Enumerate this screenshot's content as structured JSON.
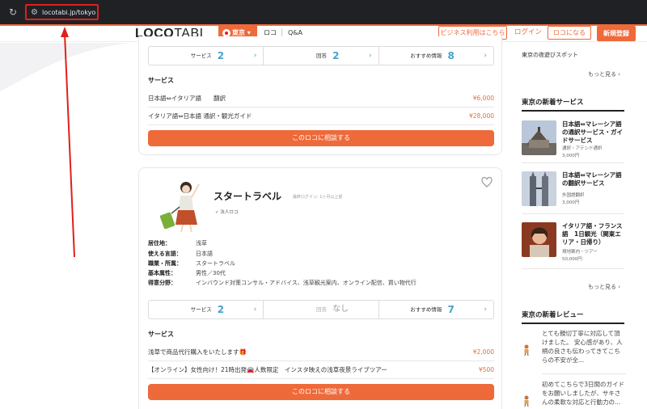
{
  "browser": {
    "url": "locotabi.jp/tokyo"
  },
  "header": {
    "logo_bold": "LOCO",
    "logo_thin": "TABI",
    "area": "東京",
    "nav": [
      "ロコ",
      "Q&A"
    ],
    "business_btn": "ビジネス利用はこちら",
    "login": "ログイン",
    "become_loco": "ロコになる",
    "signup": "新規登録",
    "accent": "#ee6a3a"
  },
  "card1": {
    "stats": [
      {
        "label": "サービス",
        "value": "2"
      },
      {
        "label": "回答",
        "value": "2"
      },
      {
        "label": "おすすめ情報",
        "value": "8"
      }
    ],
    "section": "サービス",
    "services": [
      {
        "name": "日本語⇔イタリア語　　翻訳",
        "price": "¥6,000"
      },
      {
        "name": "イタリア語⇔日本語 通訳・観光ガイド",
        "price": "¥28,000"
      }
    ],
    "cta": "このロコに相談する"
  },
  "card2": {
    "name": "スタートラベル",
    "last_login": "最終ログイン: 1ヶ月以上前",
    "corp_tag": "✓ 法人ロコ",
    "info": [
      {
        "label": "居住地：",
        "value": "浅草"
      },
      {
        "label": "使える言語：",
        "value": "日本語"
      },
      {
        "label": "職業・所属：",
        "value": "スタートラベル"
      },
      {
        "label": "基本属性：",
        "value": "男性／30代"
      },
      {
        "label": "得意分野：",
        "value": "インバウンド対策コンサル・アドバイス、浅草観光案内、オンライン配信、買い物代行"
      }
    ],
    "stats": [
      {
        "label": "サービス",
        "value": "2"
      },
      {
        "label": "回答",
        "value": "なし"
      },
      {
        "label": "おすすめ情報",
        "value": "7"
      }
    ],
    "section": "サービス",
    "services": [
      {
        "name": "浅草で商品代行購入をいたします🎁",
        "price": "¥2,000"
      },
      {
        "name": "【オンライン】女性向け！21時出発🚘人数限定　インスタ映えの浅草夜景ライブツアー",
        "price": "¥500"
      }
    ],
    "cta": "このロコに相談する"
  },
  "sidebar": {
    "top_text": "東京の夜遊びスポット",
    "more1": "もっと見る ›",
    "new_services_heading": "東京の新着サービス",
    "new_services": [
      {
        "title": "日本語⇔マレーシア語の通訳サービス・ガイドサービス",
        "category": "通訳・アテンド通訳",
        "price": "3,000円"
      },
      {
        "title": "日本語⇔マレーシア語の翻訳サービス",
        "category": "外国語翻訳",
        "price": "3,000円"
      },
      {
        "title": "イタリア語・フランス語　1日観光（関東エリア・日帰り）",
        "category": "現地案内・ツアー",
        "price": "50,000円"
      }
    ],
    "more2": "もっと見る ›",
    "new_reviews_heading": "東京の新着レビュー",
    "reviews": [
      {
        "text": "とても親切丁寧に対応して頂けました。 安心感があり、人柄の良さも伝わってきてこちらの不安が全..."
      },
      {
        "text": "初めてこちらで3日間のガイドをお願いしましたが、サキさんの柔軟な対応と行動力の..."
      }
    ]
  }
}
